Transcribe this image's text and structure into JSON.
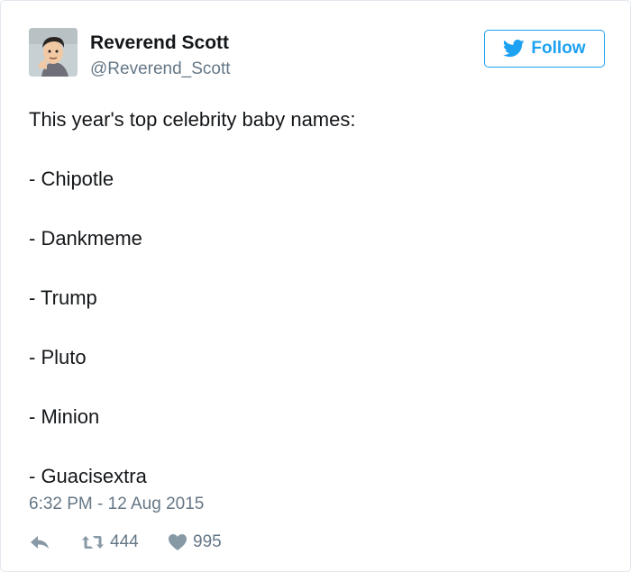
{
  "user": {
    "name": "Reverend Scott",
    "handle": "@Reverend_Scott"
  },
  "follow_button": {
    "label": "Follow",
    "icon": "twitter-bird-icon"
  },
  "tweet": {
    "text": "This year's top celebrity baby names:\n\n- Chipotle\n\n- Dankmeme\n\n- Trump\n\n- Pluto\n\n- Minion\n\n- Guacisextra",
    "timestamp": "6:32 PM - 12 Aug 2015"
  },
  "actions": {
    "reply_icon": "reply-icon",
    "retweet_icon": "retweet-icon",
    "retweet_count": "444",
    "like_icon": "heart-icon",
    "like_count": "995"
  },
  "colors": {
    "accent": "#1da1f2",
    "text": "#14171a",
    "secondary": "#657786",
    "icon": "#8899a6",
    "border": "#e1e8ed"
  }
}
